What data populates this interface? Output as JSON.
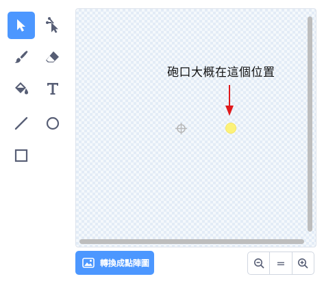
{
  "toolbar": {
    "tools": [
      {
        "name": "select",
        "icon": "select-arrow-icon",
        "active": true
      },
      {
        "name": "reshape",
        "icon": "reshape-icon",
        "active": false
      },
      {
        "name": "brush",
        "icon": "brush-icon",
        "active": false
      },
      {
        "name": "eraser",
        "icon": "eraser-icon",
        "active": false
      },
      {
        "name": "fill",
        "icon": "fill-bucket-icon",
        "active": false
      },
      {
        "name": "text",
        "icon": "text-icon",
        "active": false
      },
      {
        "name": "line",
        "icon": "line-icon",
        "active": false
      },
      {
        "name": "circle",
        "icon": "circle-icon",
        "active": false
      },
      {
        "name": "rectangle",
        "icon": "rectangle-icon",
        "active": false
      }
    ]
  },
  "canvas": {
    "annotation": "砲口大概在這個位置"
  },
  "convert_button": {
    "label": "轉換成點陣圖",
    "icon": "bitmap-image-icon"
  },
  "zoom": {
    "zoom_out": "zoom-out-icon",
    "reset_label": "=",
    "zoom_in": "zoom-in-icon"
  },
  "colors": {
    "accent": "#4c97ff",
    "icon": "#575e75",
    "arrow": "#e0191b",
    "sprite_dot": "#fcf27a"
  }
}
